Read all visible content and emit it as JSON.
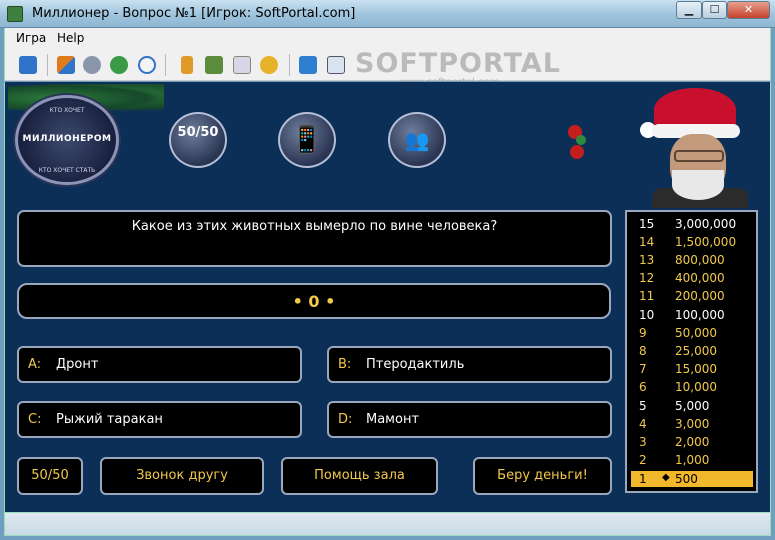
{
  "window": {
    "title": "Миллионер - Вопрос №1 [Игрок: SoftPortal.com]",
    "min_glyph": "▁",
    "max_glyph": "☐",
    "close_glyph": "✕"
  },
  "menu": {
    "game": "Игра",
    "help": "Help"
  },
  "toolbar": {
    "icons": [
      "refresh-icon",
      "bird-icon",
      "people-icon",
      "globe-icon",
      "stopwatch-icon",
      "person-icon",
      "group-icon",
      "settings-icon",
      "trophy-icon",
      "grid-icon",
      "window-icon",
      "export-icon"
    ],
    "watermark": "SOFTPORTAL",
    "watermark_url": "www.softportal.com"
  },
  "logo": {
    "top_arc": "КТО ХОЧЕТ",
    "center": "МИЛЛИОНЕРОМ",
    "bottom_arc": "КТО ХОЧЕТ СТАТЬ"
  },
  "lifeline_icons": {
    "fifty": "50/50",
    "phone": "📱",
    "audience": "👥"
  },
  "question": {
    "text": "Какое из этих животных вымерло по вине человека?",
    "timer_display": "• 0 •"
  },
  "answers": [
    {
      "letter": "A:",
      "text": "Дронт"
    },
    {
      "letter": "B:",
      "text": "Птеродактиль"
    },
    {
      "letter": "C:",
      "text": "Рыжий таракан"
    },
    {
      "letter": "D:",
      "text": "Мамонт"
    }
  ],
  "buttons": {
    "fifty": "50/50",
    "call_friend": "Звонок другу",
    "ask_audience": "Помощь зала",
    "take_money": "Беру деньги!"
  },
  "prize_ladder": [
    {
      "level": "15",
      "amount": "3,000,000",
      "milestone": true
    },
    {
      "level": "14",
      "amount": "1,500,000",
      "milestone": false
    },
    {
      "level": "13",
      "amount": "800,000",
      "milestone": false
    },
    {
      "level": "12",
      "amount": "400,000",
      "milestone": false
    },
    {
      "level": "11",
      "amount": "200,000",
      "milestone": false
    },
    {
      "level": "10",
      "amount": "100,000",
      "milestone": true
    },
    {
      "level": "9",
      "amount": "50,000",
      "milestone": false
    },
    {
      "level": "8",
      "amount": "25,000",
      "milestone": false
    },
    {
      "level": "7",
      "amount": "15,000",
      "milestone": false
    },
    {
      "level": "6",
      "amount": "10,000",
      "milestone": false
    },
    {
      "level": "5",
      "amount": "5,000",
      "milestone": true
    },
    {
      "level": "4",
      "amount": "3,000",
      "milestone": false
    },
    {
      "level": "3",
      "amount": "2,000",
      "milestone": false
    },
    {
      "level": "2",
      "amount": "1,000",
      "milestone": false
    },
    {
      "level": "1",
      "amount": "500",
      "milestone": false,
      "current": true
    }
  ],
  "colors": {
    "background": "#0c2f57",
    "gold": "#f2c94c",
    "current_rung": "#f2b82c"
  }
}
